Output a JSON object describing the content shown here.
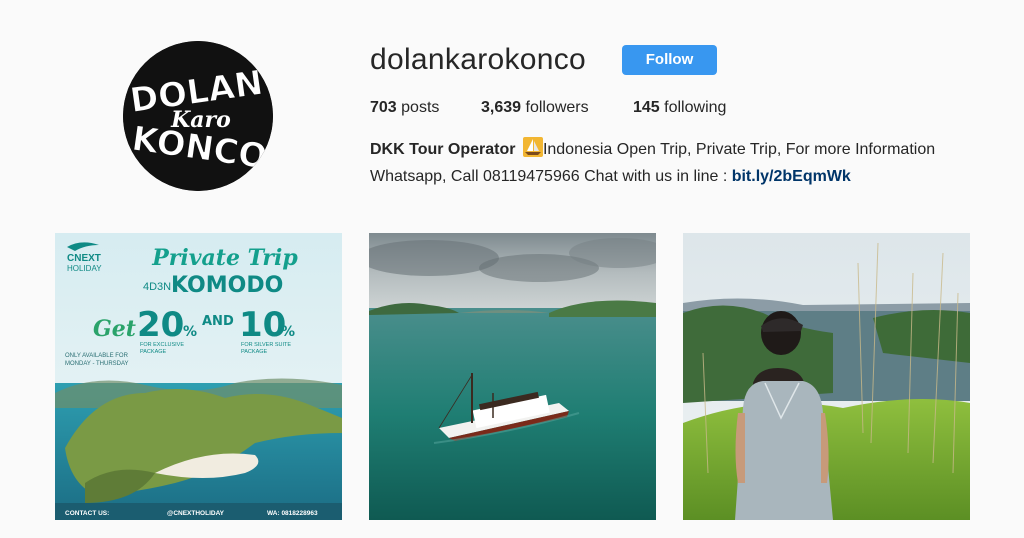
{
  "profile": {
    "username": "dolankarokonco",
    "follow_label": "Follow",
    "stats": {
      "posts_count": "703",
      "posts_label": "posts",
      "followers_count": "3,639",
      "followers_label": "followers",
      "following_count": "145",
      "following_label": "following"
    },
    "bio": {
      "name": "DKK Tour Operator",
      "emoji_icon": "sailboat-icon",
      "line1_rest": "Indonesia Open Trip, Private Trip, For more Information",
      "line2_text": "Whatsapp, Call 08119475966 Chat with us in line : ",
      "link_text": "bit.ly/2bEqmWk"
    },
    "avatar_logo": {
      "line1": "DOLAN",
      "line2": "Karo",
      "line3": "KONCO"
    }
  },
  "posts": [
    {
      "type": "promo-flyer",
      "brand_line1": "CNEXT",
      "brand_line2": "HOLIDAY",
      "headline": "Private Trip",
      "duration": "4D3N",
      "destination": "KOMODO",
      "get_label": "Get",
      "offer1_value": "20",
      "offer1_unit": "%",
      "offer1_note1": "FOR EXCLUSIVE",
      "offer1_note2": "PACKAGE",
      "and_label": "AND",
      "offer2_value": "10",
      "offer2_unit": "%",
      "offer2_note1": "FOR SILVER SUITE",
      "offer2_note2": "PACKAGE",
      "availability1": "ONLY AVAILABLE FOR",
      "availability2": "MONDAY - THURSDAY",
      "contact_label": "CONTACT US:",
      "contact_handle": "@CNEXTHOLIDAY",
      "contact_wa": "WA: 0818228963"
    },
    {
      "type": "photo",
      "subject": "boat-on-sea"
    },
    {
      "type": "photo",
      "subject": "woman-on-hill"
    }
  ],
  "colors": {
    "follow_button": "#3897f0",
    "link": "#003569",
    "background": "#fafafa",
    "flyer_accent": "#0f8a85"
  }
}
